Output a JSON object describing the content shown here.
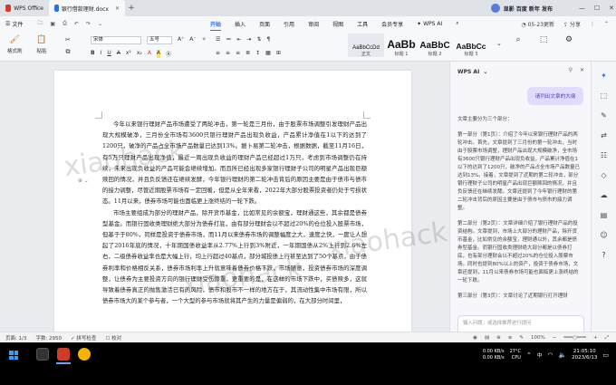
{
  "titlebar": {
    "app_tab": "WPS Office",
    "doc_tab": "银行借款理财.docx",
    "right_label": "显影 百度 新年 发布"
  },
  "menubar": {
    "file": "文件",
    "menus": [
      "开始",
      "插入",
      "页面",
      "引用",
      "审阅",
      "视图",
      "工具",
      "会员专享"
    ],
    "active": "开始",
    "wps_ai": "WPS AI",
    "comment": "05-23更新",
    "share": "分享"
  },
  "ribbon": {
    "format_brush": "格式刷",
    "paste": "粘贴",
    "font_name": "宋体",
    "font_size": "五号",
    "styles": [
      {
        "sample": "AaBbCcDd",
        "name": "正文"
      },
      {
        "sample": "AaBb",
        "name": "标题 1"
      },
      {
        "sample": "AaBbC",
        "name": "标题 2"
      },
      {
        "sample": "AaBbCc",
        "name": "标题 3"
      }
    ]
  },
  "document": {
    "paragraphs": [
      "今年以来银行理财产品市场遭受了两轮冲击，第一轮是三月份，由于股票市场调整引发理财产品出现大规模破净，三月份全市场有3600只银行理财产品出现负收益，产品累计净值在1以下的达到了1200只，破净的产品占全市场产品数量已达到13%。据卜易第二轮冲击，根据数据，截至11月16日，有5万只理财产品出现净值，最近一周出现负收益的理财产品已经超过1万只，考虑到市场调整仍在持续，未来出现负收益的产品可能会继续增加。而且所已经出现多家银行理财子公司的明星产品出现巨额赎回的情况，并且负反馈还在继续发酵，今年银行理财的第二轮冲击背后的原因主要是由于债市与债市的接力调整，尽管近期股票市场有一定回暖，但是从全年来看，2022年大部分股票投资者仍处于亏损状态。11月以来，债券市场可能也面临更上涨终结的一轮下跌。",
      "市场主要组成为部分的理财产品，除开货币基金，比如常见的余额宝，理财通这些，其余都是债券型基金。而银行固收类理财绝大部分为债券打底，由有部分理财会以不超过20%的仓位投入股票市场，但基于于80%，同样是投资于债券市场，而11月以来债券市场的调整幅度之大，速度之快，一度让人想起了2016年底的情况，十年期国债收益率从2.77%上行到3%附近，一年期国债从2%上行到2.6%左右，二级债券收益率也是大幅上行，均上行超过40基点，部分城投债上行甚至达到了50个基点，由于债券利率和价格相反关系，债券市场利率上升就意味着债券价格下跌，市场随意，投资债券市场的深度调整，让债券为主要投资方向的银行理财受伤惨重，更重要的是，在这样的市场下跌中，买债赎多，这就导致着债券真正的抛售激活已有的风险，债市和股市不一样的地方在于，其流动性集中市场有限，所以债券市场大的某个参与者，一个大型的参与市场就将其产生的力量是偏弱的，在大部分时间里，"
    ],
    "watermark": "xiaohack"
  },
  "ai_panel": {
    "title": "WPS AI",
    "user_prompt": "请列出文章的大纲",
    "answer": [
      "文章主要分为三个部分：",
      "第一部分（第1页）：介绍了今年以来银行理财产品的两轮冲击。首先，文章提到了三月份的第一轮冲击，当时由于股票市场调整，理财产品出现大规模破净，全市场有3600只银行理财产品出现负收益，产品累计净值在1以下的达到了1200只，破净的产品占全市场产品数量已达到13%。接着，文章提到了近期的第二轮冲击，部分银行理财子公司的明星产品出现巨额赎回的情况，并且负反馈还在继续发酵。文章还提到了今年银行理财的第二轮冲击背后的原因主要是由于债市与债市的接力调整。",
      "第二部分（第2页）：文章详细介绍了银行理财产品的投资结构。文章提到，市场上大部分的理财产品，除开货币基金，比如常见的余额宝，理财通以外，其余都是债券型基金。而银行固收类理财绝大部分都是以债券打底，也有部分理财会以不超过20%的仓位投入股票市场。同时也提到80%以上的资产，投资于债券市场，文章还提到，11月以来债券市场可能也面临更上涨终结的一轮下跌。",
      "第三部分（第3页）：文章讨论了近期银行打开理财"
    ],
    "input_placeholder": "输入问题，或选择推荐进行提问"
  },
  "statusbar": {
    "page": "页面: 1/3",
    "words": "字数: 2950",
    "spell": "拼写检查",
    "proof": "校对",
    "zoom": "100%"
  },
  "taskbar": {
    "net_up": "0.00 KB/s",
    "net_down": "0.00 KB/s",
    "temp": "27°C",
    "cpu": "CPU",
    "lang": "中",
    "time": "21:05:10",
    "date": "2023/6/13"
  },
  "colors": {
    "accent": "#2f6fe6",
    "ai_purple": "#5137b8",
    "wps_red": "#d23a2c"
  }
}
